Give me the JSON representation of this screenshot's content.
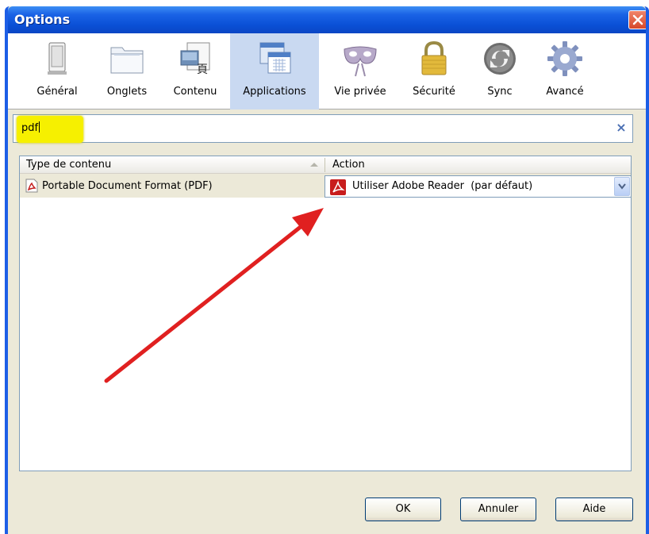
{
  "window": {
    "title": "Options"
  },
  "panes": [
    {
      "label": "Général",
      "icon": "general-icon"
    },
    {
      "label": "Onglets",
      "icon": "tabs-icon"
    },
    {
      "label": "Contenu",
      "icon": "content-icon"
    },
    {
      "label": "Applications",
      "icon": "applications-icon",
      "selected": true
    },
    {
      "label": "Vie privée",
      "icon": "privacy-mask-icon"
    },
    {
      "label": "Sécurité",
      "icon": "padlock-icon"
    },
    {
      "label": "Sync",
      "icon": "sync-icon"
    },
    {
      "label": "Avancé",
      "icon": "gear-icon"
    }
  ],
  "search": {
    "value": "pdf",
    "clear_label": "×"
  },
  "table": {
    "columns": [
      "Type de contenu",
      "Action"
    ],
    "rows": [
      {
        "type": "Portable Document Format (PDF)",
        "action": "Utiliser Adobe Reader  (par défaut)"
      }
    ]
  },
  "buttons": {
    "ok": "OK",
    "cancel": "Annuler",
    "help": "Aide"
  },
  "colors": {
    "titlebar": "#0a50d6",
    "selected_pane": "#c9d9f1",
    "highlight": "#f6f000",
    "arrow": "#e02020"
  }
}
